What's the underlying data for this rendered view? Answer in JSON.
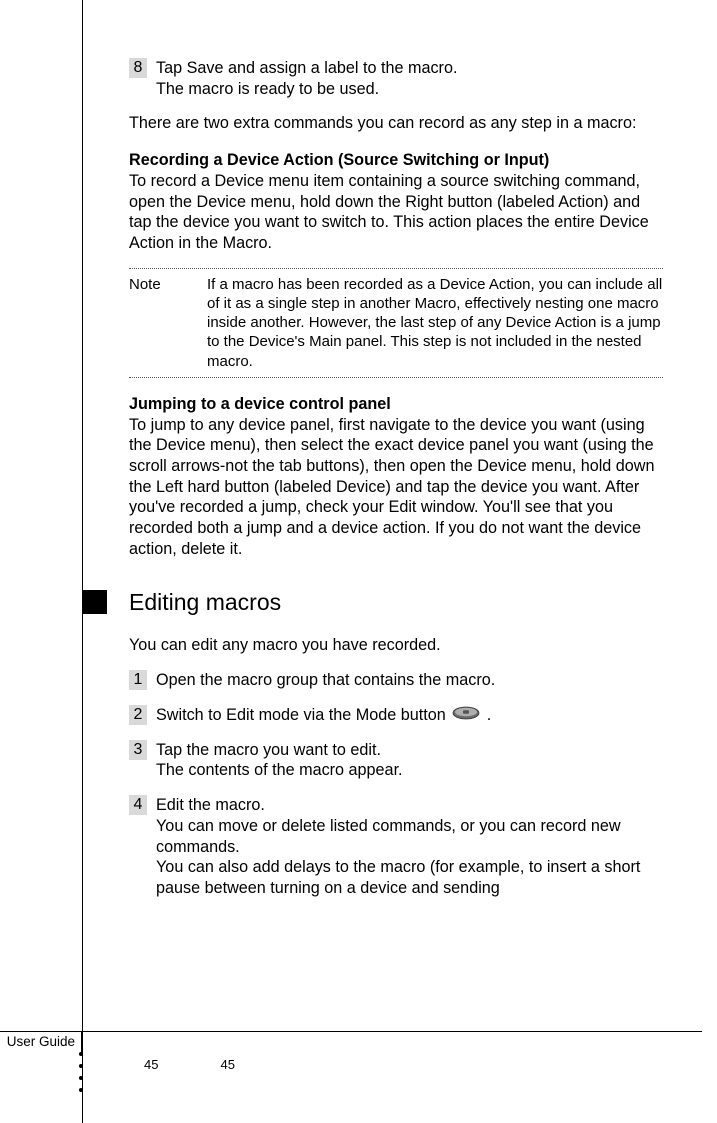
{
  "step8": {
    "num": "8",
    "line1": "Tap Save and assign a label to the macro.",
    "line2": "The macro is ready to be used."
  },
  "intro": "There are two extra commands you can record as any step in a macro:",
  "recording": {
    "heading": "Recording a Device Action (Source Switching or Input)",
    "body": "To record a Device menu item containing a source switching command, open the Device menu, hold down the Right button (labeled Action) and tap the device you want to switch to. This action places the entire Device Action in the Macro."
  },
  "note": {
    "label": "Note",
    "body": "If a macro has been recorded as a Device Action, you can include all of it as a single step in another Macro, effectively nesting one macro inside another. However, the last step of any Device Action is a jump to the Device's Main panel. This step is not included in the nested macro."
  },
  "jumping": {
    "heading": "Jumping to a device control panel",
    "body": "To jump to any device panel, first navigate to the device you want (using the Device menu), then select the exact device panel you want (using the scroll arrows-not the tab buttons), then open the Device menu, hold down the Left hard button (labeled Device) and tap the device you want. After you've recorded a jump, check your Edit window. You'll see that you recorded both a jump and a device action. If you do not want the device action, delete it."
  },
  "section": {
    "title": "Editing macros",
    "intro": "You can edit any macro you have recorded."
  },
  "steps": [
    {
      "num": "1",
      "body": "Open the macro group that contains the macro."
    },
    {
      "num": "2",
      "prefix": "Switch to Edit mode via the Mode button ",
      "suffix": " ."
    },
    {
      "num": "3",
      "line1": "Tap the macro you want to edit.",
      "line2": "The contents of the macro appear."
    },
    {
      "num": "4",
      "line1": "Edit the macro.",
      "line2": "You can move or delete listed commands, or you can record new commands.",
      "line3": "You can also add delays to the macro (for example, to insert a short pause between turning on a device and sending"
    }
  ],
  "footer": {
    "label": "User Guide",
    "page1": "45",
    "page2": "45"
  }
}
